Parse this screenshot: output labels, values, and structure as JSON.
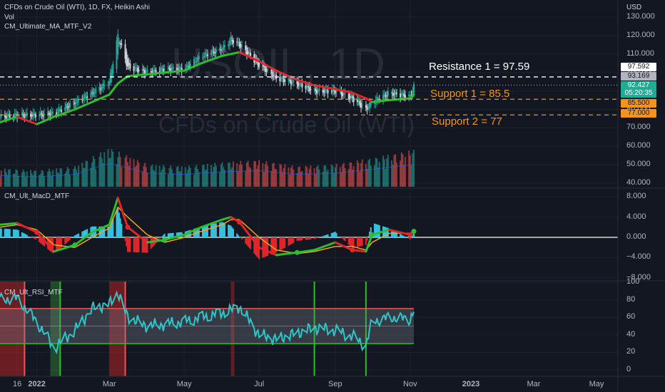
{
  "header": {
    "symbol_line": "CFDs on Crude Oil (WTI), 1D, FX, Heikin Ashi",
    "vol": "Vol",
    "ma_indicator": "CM_Ultimate_MA_MTF_V2",
    "macd_indicator": "CM_Ult_MacD_MTF",
    "rsi_indicator": "CM_Ult_RSI_MTF",
    "currency": "USD"
  },
  "watermark": {
    "ticker": "USOIL, 1D",
    "name": "CFDs on Crude Oil (WTI)"
  },
  "annotations": {
    "resistance": "Resistance 1 = 97.59",
    "support1": "Support 1 = 85.5",
    "support2": "Support 2 = 77"
  },
  "price_tags": {
    "resistance": "97.592",
    "prev_close": "93.169",
    "last": "92.427",
    "countdown": "05:20:35",
    "support1": "85.500",
    "support2": "77.000"
  },
  "colors": {
    "background": "#131722",
    "bull": "#26a69a",
    "bear": "#ef5350",
    "ma_up": "#2ebd2e",
    "ma_down": "#e0262b",
    "support": "#f7931a",
    "resistance": "#ffffff",
    "last_price": "#22ab94",
    "rsi_line": "#2ec5c9",
    "macd_hist_up": "#35c0e0",
    "macd_hist_down": "#e0262b",
    "signal": "#f7a21b"
  },
  "axes": {
    "price_ticks": [
      "130.000",
      "120.000",
      "110.000",
      "100.000",
      "90.000",
      "80.000",
      "70.000",
      "60.000",
      "50.000",
      "40.000"
    ],
    "macd_ticks": [
      "8.000",
      "4.000",
      "0.000",
      "−4.000",
      "−8.000"
    ],
    "rsi_ticks": [
      "100",
      "80",
      "60",
      "40",
      "20",
      "0"
    ],
    "x_ticks": [
      "16",
      "2022",
      "Mar",
      "May",
      "Jul",
      "Sep",
      "Nov",
      "2023",
      "Mar",
      "May"
    ]
  },
  "chart_data": [
    {
      "type": "line",
      "title": "CFDs on Crude Oil (WTI), 1D, FX, Heikin Ashi",
      "x": [
        "2021-12-02",
        "2021-12-16",
        "2022-01-01",
        "2022-01-15",
        "2022-02-01",
        "2022-02-15",
        "2022-03-01",
        "2022-03-08",
        "2022-03-16",
        "2022-04-01",
        "2022-04-15",
        "2022-05-01",
        "2022-05-15",
        "2022-06-01",
        "2022-06-08",
        "2022-06-15",
        "2022-07-01",
        "2022-07-15",
        "2022-08-01",
        "2022-08-15",
        "2022-09-01",
        "2022-09-15",
        "2022-09-26",
        "2022-10-01",
        "2022-10-15",
        "2022-11-01",
        "2022-11-04"
      ],
      "series": [
        {
          "name": "Heikin Ashi",
          "values": [
            76,
            77,
            77,
            78,
            84,
            89,
            95,
            120,
            103,
            100,
            102,
            102,
            109,
            113,
            118,
            115,
            104,
            97,
            94,
            90,
            90,
            86,
            80,
            84,
            89,
            87,
            92.4
          ]
        },
        {
          "name": "CM_Ultimate_MA_MTF_V2",
          "values": [
            73,
            76,
            72,
            76,
            80,
            84,
            88,
            94,
            98,
            99,
            100,
            101,
            105,
            109,
            110,
            111,
            106,
            101,
            96,
            93,
            91,
            89,
            86,
            84,
            85,
            86,
            88
          ]
        }
      ],
      "levels": [
        {
          "name": "Resistance 1",
          "value": 97.59
        },
        {
          "name": "Support 1",
          "value": 85.5
        },
        {
          "name": "Support 2",
          "value": 77
        }
      ],
      "ylim": [
        40,
        130
      ],
      "y_scale": "linear",
      "grid": true,
      "legend": "top-left"
    },
    {
      "type": "bar",
      "title": "Vol",
      "x": [
        "2021-12-02",
        "2022-01-01",
        "2022-02-01",
        "2022-03-01",
        "2022-04-01",
        "2022-05-01",
        "2022-06-01",
        "2022-07-01",
        "2022-08-01",
        "2022-09-01",
        "2022-10-01",
        "2022-11-04"
      ],
      "values": [
        0.45,
        0.4,
        0.5,
        0.95,
        0.55,
        0.5,
        0.6,
        0.65,
        0.5,
        0.55,
        0.7,
        0.9
      ],
      "grid": true
    },
    {
      "type": "line",
      "title": "CM_Ult_MacD_MTF",
      "x": [
        "2021-12-02",
        "2021-12-16",
        "2022-01-01",
        "2022-01-15",
        "2022-02-01",
        "2022-02-15",
        "2022-03-01",
        "2022-03-08",
        "2022-03-16",
        "2022-04-01",
        "2022-04-15",
        "2022-05-01",
        "2022-05-15",
        "2022-06-01",
        "2022-06-08",
        "2022-06-15",
        "2022-07-01",
        "2022-07-15",
        "2022-08-01",
        "2022-08-15",
        "2022-09-01",
        "2022-09-15",
        "2022-09-26",
        "2022-10-01",
        "2022-10-15",
        "2022-11-01",
        "2022-11-04"
      ],
      "series": [
        {
          "name": "MACD",
          "values": [
            2.5,
            2.8,
            1.0,
            -2.8,
            -1.5,
            1.0,
            2.5,
            7.8,
            2.0,
            -1.0,
            -0.5,
            0.5,
            2.0,
            3.5,
            4.0,
            3.0,
            -2.0,
            -3.5,
            -3.0,
            -2.5,
            -1.0,
            -2.5,
            -2.8,
            0.5,
            1.5,
            0.5,
            1.2
          ]
        },
        {
          "name": "Signal",
          "values": [
            2.0,
            2.5,
            1.5,
            -1.5,
            -2.0,
            0.0,
            1.8,
            6.0,
            4.0,
            0.5,
            -1.0,
            0.0,
            1.2,
            2.5,
            3.5,
            3.5,
            0.0,
            -2.5,
            -3.2,
            -2.8,
            -1.8,
            -1.8,
            -2.5,
            -1.0,
            0.8,
            0.8,
            1.0
          ]
        }
      ],
      "ylim": [
        -8,
        8
      ],
      "grid": true
    },
    {
      "type": "line",
      "title": "CM_Ult_RSI_MTF",
      "x": [
        "2021-12-02",
        "2021-12-16",
        "2022-01-01",
        "2022-01-15",
        "2022-02-01",
        "2022-02-15",
        "2022-03-01",
        "2022-03-08",
        "2022-03-16",
        "2022-04-01",
        "2022-04-15",
        "2022-05-01",
        "2022-05-15",
        "2022-06-01",
        "2022-06-08",
        "2022-06-15",
        "2022-07-01",
        "2022-07-15",
        "2022-08-01",
        "2022-08-15",
        "2022-09-01",
        "2022-09-15",
        "2022-09-26",
        "2022-10-01",
        "2022-10-15",
        "2022-11-01",
        "2022-11-04"
      ],
      "series": [
        {
          "name": "RSI",
          "values": [
            80,
            82,
            55,
            25,
            45,
            70,
            75,
            88,
            60,
            50,
            52,
            55,
            60,
            65,
            68,
            72,
            40,
            35,
            42,
            48,
            45,
            38,
            28,
            55,
            60,
            58,
            68
          ]
        }
      ],
      "bands": [
        70,
        30
      ],
      "ylim": [
        0,
        100
      ],
      "grid": true
    }
  ]
}
